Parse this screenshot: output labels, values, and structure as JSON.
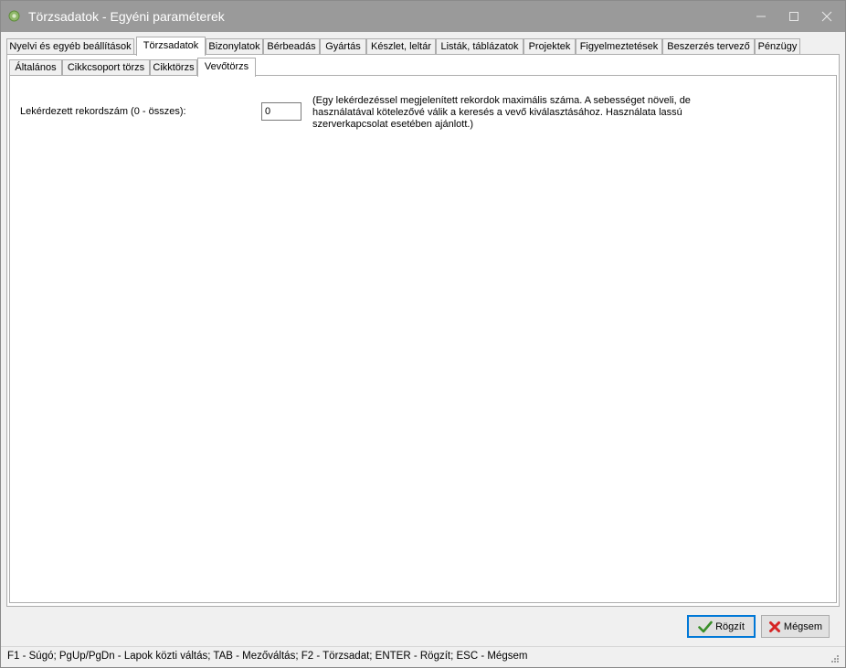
{
  "window": {
    "title": "Törzsadatok - Egyéni paraméterek"
  },
  "main_tabs": [
    {
      "label": "Nyelvi és egyéb beállítások",
      "active": false
    },
    {
      "label": "Törzsadatok",
      "active": true
    },
    {
      "label": "Bizonylatok",
      "active": false
    },
    {
      "label": "Bérbeadás",
      "active": false
    },
    {
      "label": "Gyártás",
      "active": false
    },
    {
      "label": "Készlet, leltár",
      "active": false
    },
    {
      "label": "Listák, táblázatok",
      "active": false
    },
    {
      "label": "Projektek",
      "active": false
    },
    {
      "label": "Figyelmeztetések",
      "active": false
    },
    {
      "label": "Beszerzés tervező",
      "active": false
    },
    {
      "label": "Pénzügy",
      "active": false
    }
  ],
  "sub_tabs": [
    {
      "label": "Általános",
      "active": false
    },
    {
      "label": "Cikkcsoport törzs",
      "active": false
    },
    {
      "label": "Cikktörzs",
      "active": false
    },
    {
      "label": "Vevőtörzs",
      "active": true
    }
  ],
  "form": {
    "record_count_label": "Lekérdezett rekordszám (0 - összes):",
    "record_count_value": "0",
    "record_count_note": "(Egy lekérdezéssel megjelenített rekordok maximális száma.  A sebességet növeli, de használatával kötelezővé válik a keresés a vevő kiválasztásához. Használata lassú szerverkapcsolat esetében ajánlott.)"
  },
  "buttons": {
    "ok_label": "Rögzít",
    "cancel_label": "Mégsem"
  },
  "statusbar": {
    "text": "F1 - Súgó; PgUp/PgDn - Lapok közti váltás; TAB - Mezőváltás; F2 - Törzsadat; ENTER - Rögzít; ESC - Mégsem"
  },
  "icons": {
    "app": "app-logo-icon",
    "minimize": "minimize-icon",
    "maximize": "maximize-icon",
    "close": "close-icon",
    "ok": "checkmark-icon",
    "cancel": "cross-icon",
    "grip": "resize-grip-icon"
  },
  "colors": {
    "titlebar": "#9a9a9a",
    "focus_border": "#0078d7",
    "check_green": "#3a8f2a",
    "cross_red": "#d62424"
  }
}
